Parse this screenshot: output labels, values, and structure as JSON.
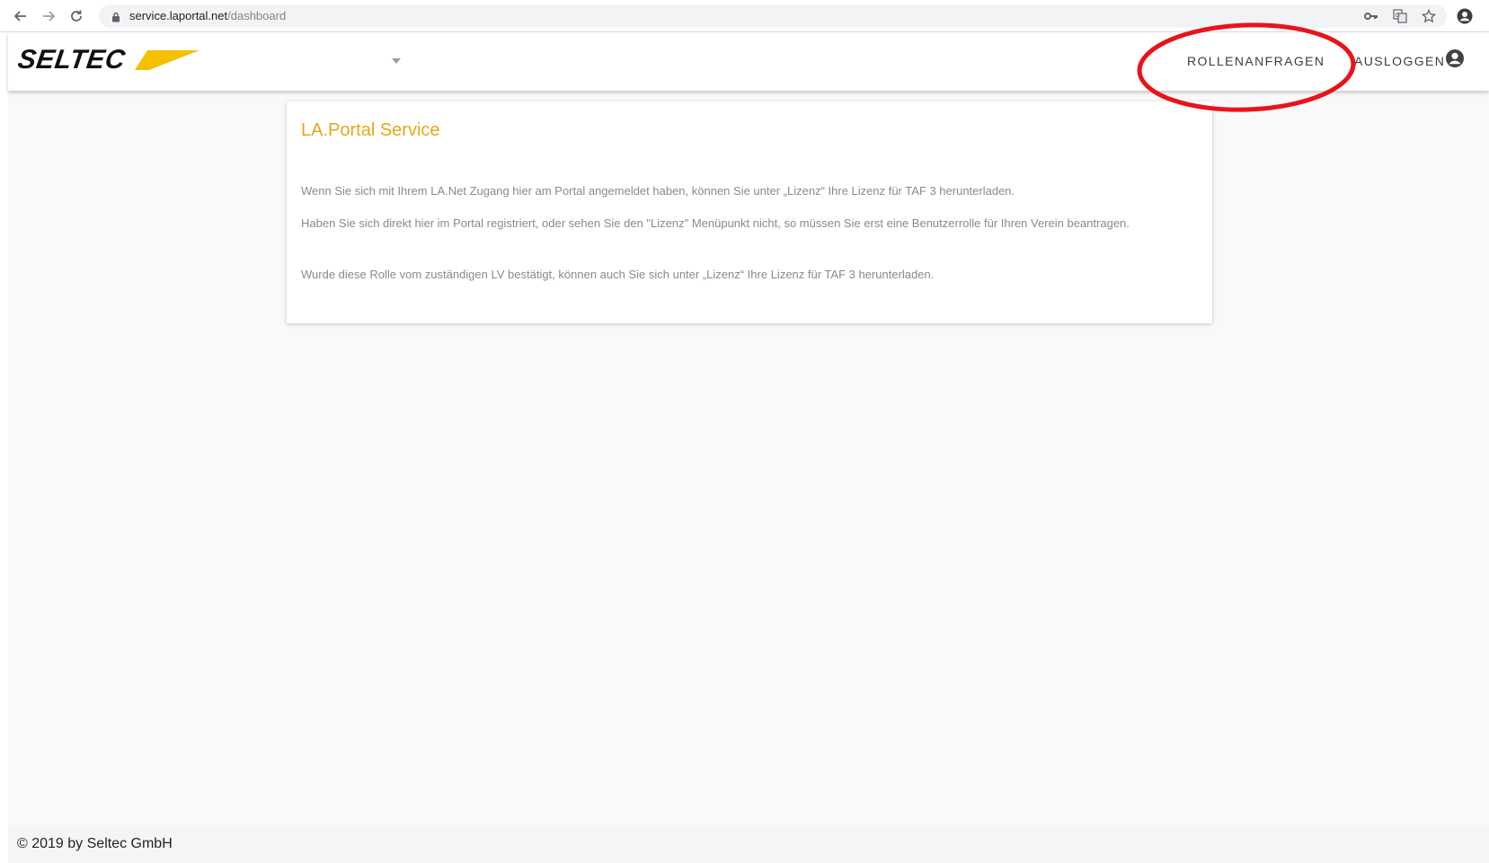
{
  "browser": {
    "url_host": "service.laportal.net",
    "url_path": "/dashboard"
  },
  "header": {
    "logo_text": "SELTEC",
    "nav": {
      "role_requests": "ROLLENANFRAGEN",
      "logout": "AUSLOGGEN"
    }
  },
  "card": {
    "title": "LA.Portal Service",
    "paragraphs": [
      "Wenn Sie sich mit Ihrem LA.Net Zugang hier am Portal angemeldet haben, können Sie unter „Lizenz“ Ihre Lizenz für TAF 3 herunterladen.",
      "Haben Sie sich direkt hier im Portal registriert, oder sehen Sie den \"Lizenz\" Menüpunkt nicht, so müssen Sie erst eine Benutzerrolle für Ihren Verein beantragen.",
      "Wurde diese Rolle vom zuständigen LV bestätigt, können auch Sie sich unter „Lizenz“ Ihre Lizenz für TAF 3 herunterladen."
    ]
  },
  "footer": {
    "copyright": "© 2019 by Seltec GmbH"
  },
  "colors": {
    "accent": "#e6a817",
    "logo_swoosh": "#f5c000",
    "annotation": "#e8141b",
    "page_bg": "#f9f9f9"
  },
  "icons": [
    "back-arrow-icon",
    "forward-arrow-icon",
    "reload-icon",
    "lock-icon",
    "key-icon",
    "translate-icon",
    "star-icon",
    "profile-icon",
    "chevron-down-icon",
    "account-circle-icon"
  ]
}
